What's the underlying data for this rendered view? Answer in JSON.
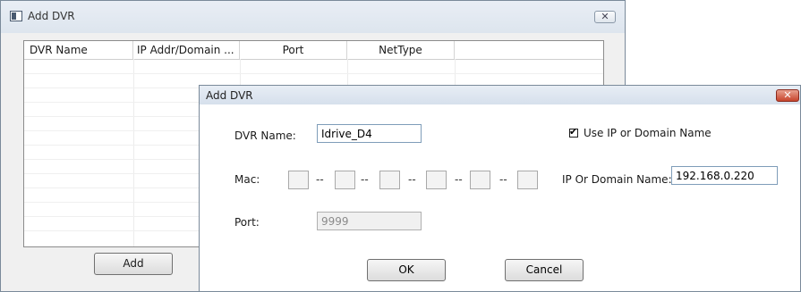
{
  "bg_window": {
    "title": "Add DVR",
    "close_glyph": "✕",
    "table": {
      "headers": [
        "DVR Name",
        "IP Addr/Domain ...",
        "Port",
        "NetType"
      ]
    },
    "add_button": "Add"
  },
  "dialog": {
    "title": "Add DVR",
    "close_glyph": "✕",
    "dvr_name_label": "DVR Name:",
    "dvr_name_value": "Idrive_D4",
    "use_ip_label": "Use IP or Domain Name",
    "use_ip_checked": true,
    "mac_label": "Mac:",
    "mac_separator": "--",
    "ip_label": "IP Or Domain Name:",
    "ip_value": "192.168.0.220",
    "port_label": "Port:",
    "port_value": "9999",
    "ok_button": "OK",
    "cancel_button": "Cancel"
  }
}
